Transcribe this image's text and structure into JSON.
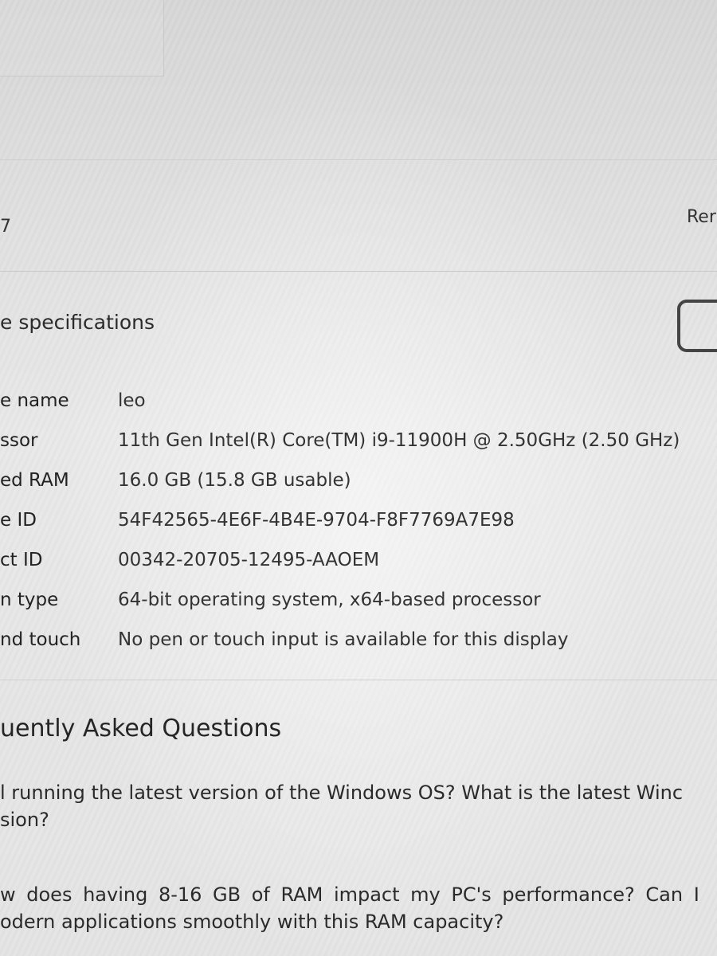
{
  "header": {
    "left_label": "7",
    "rename_button": "Rer"
  },
  "specs": {
    "heading": "e specifications",
    "rows": [
      {
        "label": "e name",
        "value": "leo"
      },
      {
        "label": "ssor",
        "value": "11th Gen Intel(R) Core(TM) i9-11900H @ 2.50GHz (2.50 GHz)"
      },
      {
        "label": "ed RAM",
        "value": "16.0 GB (15.8 GB usable)"
      },
      {
        "label": "e ID",
        "value": "54F42565-4E6F-4B4E-9704-F8F7769A7E98"
      },
      {
        "label": "ct ID",
        "value": "00342-20705-12495-AAOEM"
      },
      {
        "label": "n type",
        "value": "64-bit operating system, x64-based processor"
      },
      {
        "label": "nd touch",
        "value": "No pen or touch input is available for this display"
      }
    ]
  },
  "faq": {
    "heading": "uently Asked Questions",
    "items": [
      {
        "line1": "l running the latest version of the Windows OS? What is the latest Winc",
        "line2": "sion?"
      },
      {
        "line1": "w does having 8-16 GB of RAM impact my PC's performance? Can I",
        "line2": "odern applications smoothly with this RAM capacity?"
      }
    ]
  }
}
